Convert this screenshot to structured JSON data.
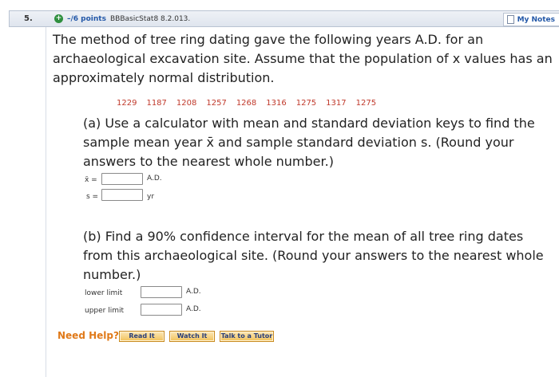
{
  "header": {
    "question_number": "5.",
    "points": "–/6 points",
    "source": "BBBasicStat8 8.2.013.",
    "notes_label": "My Notes"
  },
  "problem": {
    "intro": "The method of tree ring dating gave the following years A.D. for an archaeological excavation site. Assume that the population of x values has an approximately normal distribution.",
    "data": [
      "1229",
      "1187",
      "1208",
      "1257",
      "1268",
      "1316",
      "1275",
      "1317",
      "1275"
    ]
  },
  "part_a": {
    "text": "(a) Use a calculator with mean and standard deviation keys to find the sample mean year x̄ and sample standard deviation s. (Round your answers to the nearest whole number.)",
    "mean_label": "x̄ =",
    "mean_value": "",
    "mean_unit": "A.D.",
    "sd_label": "s =",
    "sd_value": "",
    "sd_unit": "yr"
  },
  "part_b": {
    "text": "(b) Find a 90% confidence interval for the mean of all tree ring dates from this archaeological site. (Round your answers to the nearest whole number.)",
    "lower_label": "lower limit",
    "lower_value": "",
    "lower_unit": "A.D.",
    "upper_label": "upper limit",
    "upper_value": "",
    "upper_unit": "A.D."
  },
  "help": {
    "label": "Need Help?",
    "read_it": "Read It",
    "watch_it": "Watch It",
    "talk_tutor": "Talk to a Tutor"
  }
}
